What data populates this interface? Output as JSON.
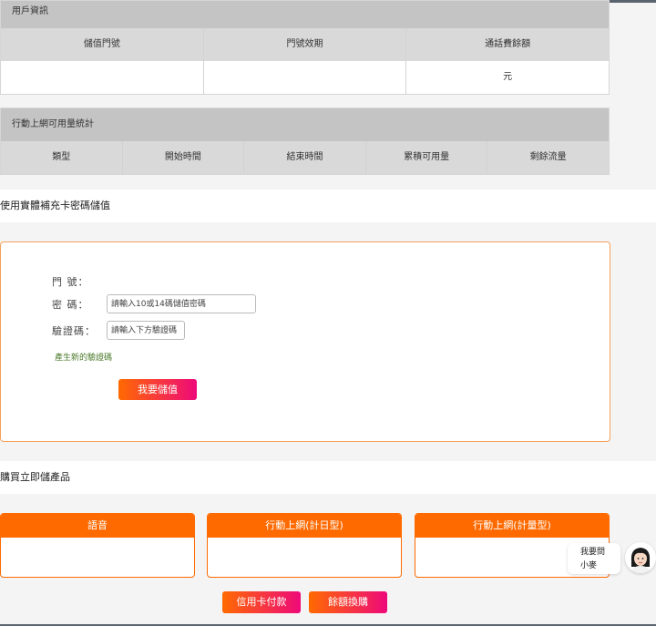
{
  "user_info": {
    "title": "用戶資訊",
    "columns": [
      "儲值門號",
      "門號效期",
      "通話費餘額"
    ],
    "values": [
      "",
      "",
      "元"
    ]
  },
  "mobile_data": {
    "title": "行動上網可用量統計",
    "columns": [
      "類型",
      "開始時間",
      "結束時間",
      "累積可用量",
      "剩餘流量"
    ]
  },
  "topup_section": {
    "title": "使用實體補充卡密碼儲值",
    "phone_label": "門 號：",
    "password_label": "密 碼：",
    "password_placeholder": "請輸入10或14碼儲值密碼",
    "captcha_label": "驗證碼：",
    "captcha_placeholder": "請輸入下方驗證碼",
    "new_captcha_link": "產生新的驗證碼",
    "submit_label": "我要儲值"
  },
  "purchase_section": {
    "title": "購買立即儲產品",
    "cards": [
      "語音",
      "行動上網(計日型)",
      "行動上網(計量型)"
    ],
    "pay_label": "信用卡付款",
    "balance_label": "餘額換購"
  },
  "chat": {
    "line1": "我要問",
    "line2": "小麥"
  },
  "colors": {
    "accent": "#ff6a00",
    "gradient_end": "#ee0979",
    "link_green": "#4b7a2a"
  }
}
